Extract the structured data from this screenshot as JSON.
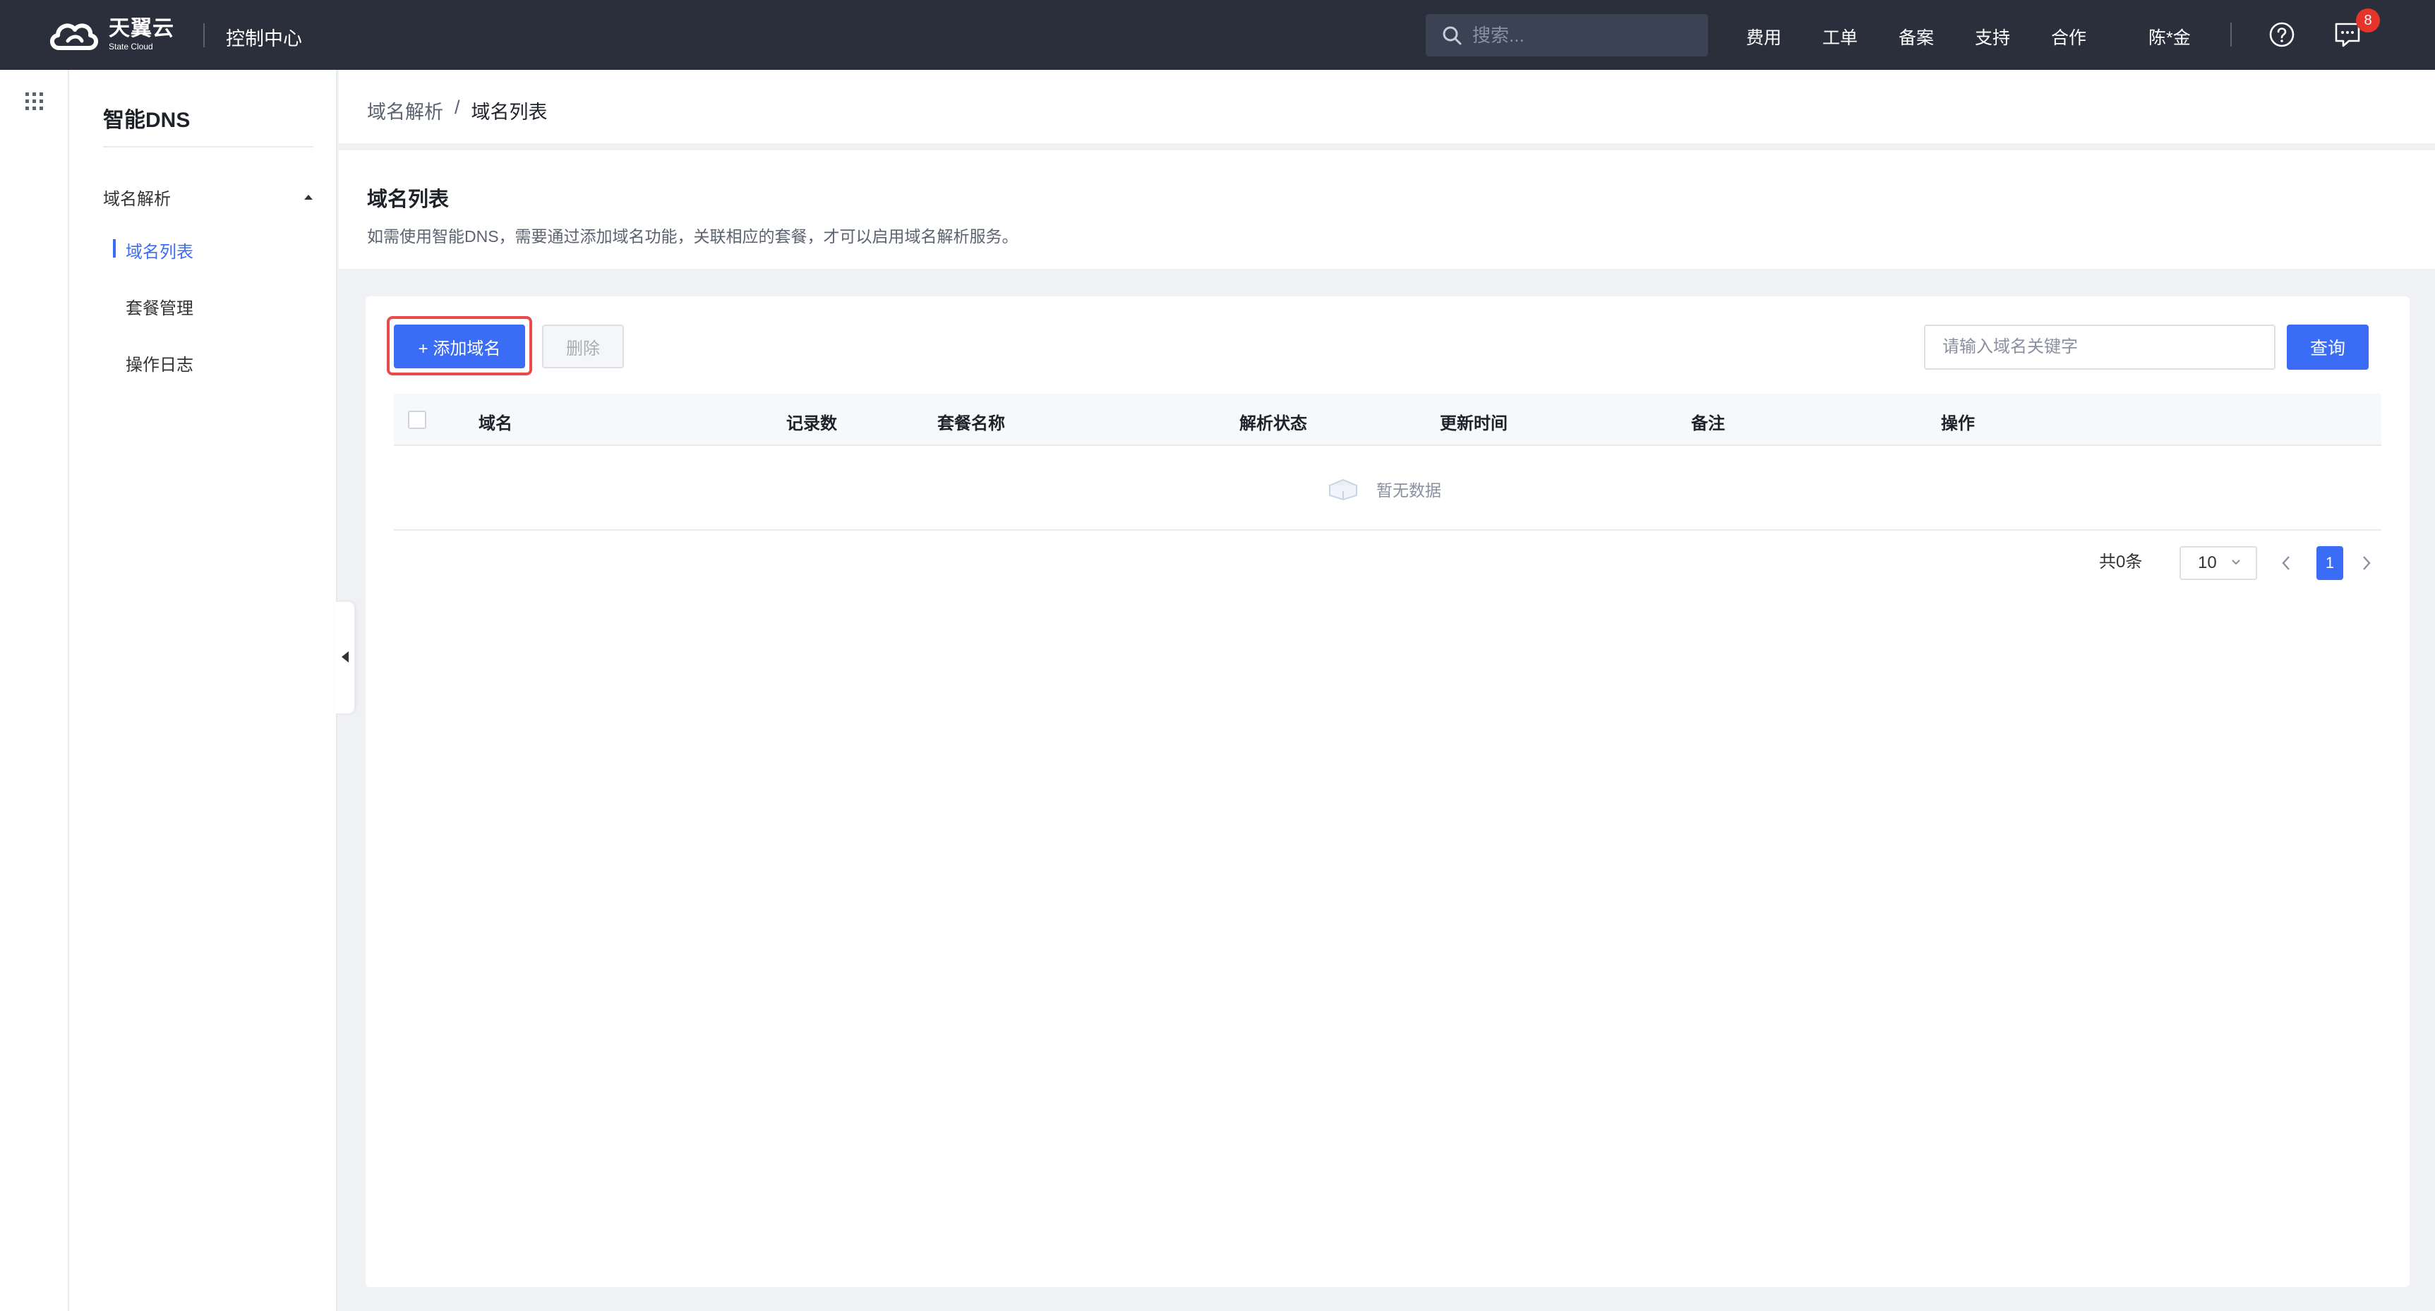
{
  "topbar": {
    "brand_cn": "天翼云",
    "brand_en": "State Cloud",
    "console_title": "控制中心",
    "search_placeholder": "搜索...",
    "nav": [
      "费用",
      "工单",
      "备案",
      "支持",
      "合作"
    ],
    "user": "陈*金",
    "message_count": "8"
  },
  "sidebar": {
    "title": "智能DNS",
    "group_label": "域名解析",
    "items": [
      "域名列表",
      "套餐管理",
      "操作日志"
    ],
    "active_index": 0
  },
  "breadcrumb": {
    "parent": "域名解析",
    "separator": "/",
    "current": "域名列表"
  },
  "page": {
    "title": "域名列表",
    "description": "如需使用智能DNS，需要通过添加域名功能，关联相应的套餐，才可以启用域名解析服务。"
  },
  "toolbar": {
    "add_label": "+ 添加域名",
    "delete_label": "删除",
    "keyword_placeholder": "请输入域名关键字",
    "query_label": "查询"
  },
  "table": {
    "columns": [
      "域名",
      "记录数",
      "套餐名称",
      "解析状态",
      "更新时间",
      "备注",
      "操作"
    ],
    "rows": [],
    "empty_text": "暂无数据"
  },
  "pagination": {
    "total": "共0条",
    "page_size": "10",
    "current_page": "1"
  },
  "colors": {
    "topbar_bg": "#2a2f3b",
    "primary": "#3b6cf6",
    "highlight": "#e94b4b",
    "badge": "#e5352b"
  }
}
